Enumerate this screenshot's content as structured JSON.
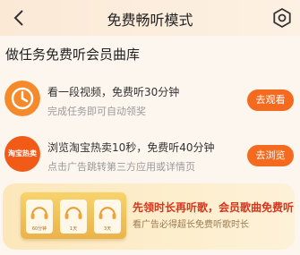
{
  "header": {
    "title": "免费畅听模式"
  },
  "section": {
    "title": "做任务免费听会员曲库"
  },
  "tasks": [
    {
      "title": "看一段视频，免费听30分钟",
      "subtitle": "完成任务即可自动领奖",
      "button": "去观看",
      "icon": "clock-icon",
      "color": "#f6892a"
    },
    {
      "title": "浏览淘宝热卖10秒，免费听40分钟",
      "subtitle": "点击广告跳转第三方应用或详情页",
      "button": "去浏览",
      "icon": "taobao-logo-icon",
      "icon_text": "淘宝热卖",
      "color": "#f25a17"
    }
  ],
  "banner": {
    "title": "先领时长再听歌，会员歌曲免费听",
    "subtitle": "看广告必得超长免费听歌时长",
    "slots": [
      "60分钟",
      "1天",
      "3天"
    ]
  }
}
